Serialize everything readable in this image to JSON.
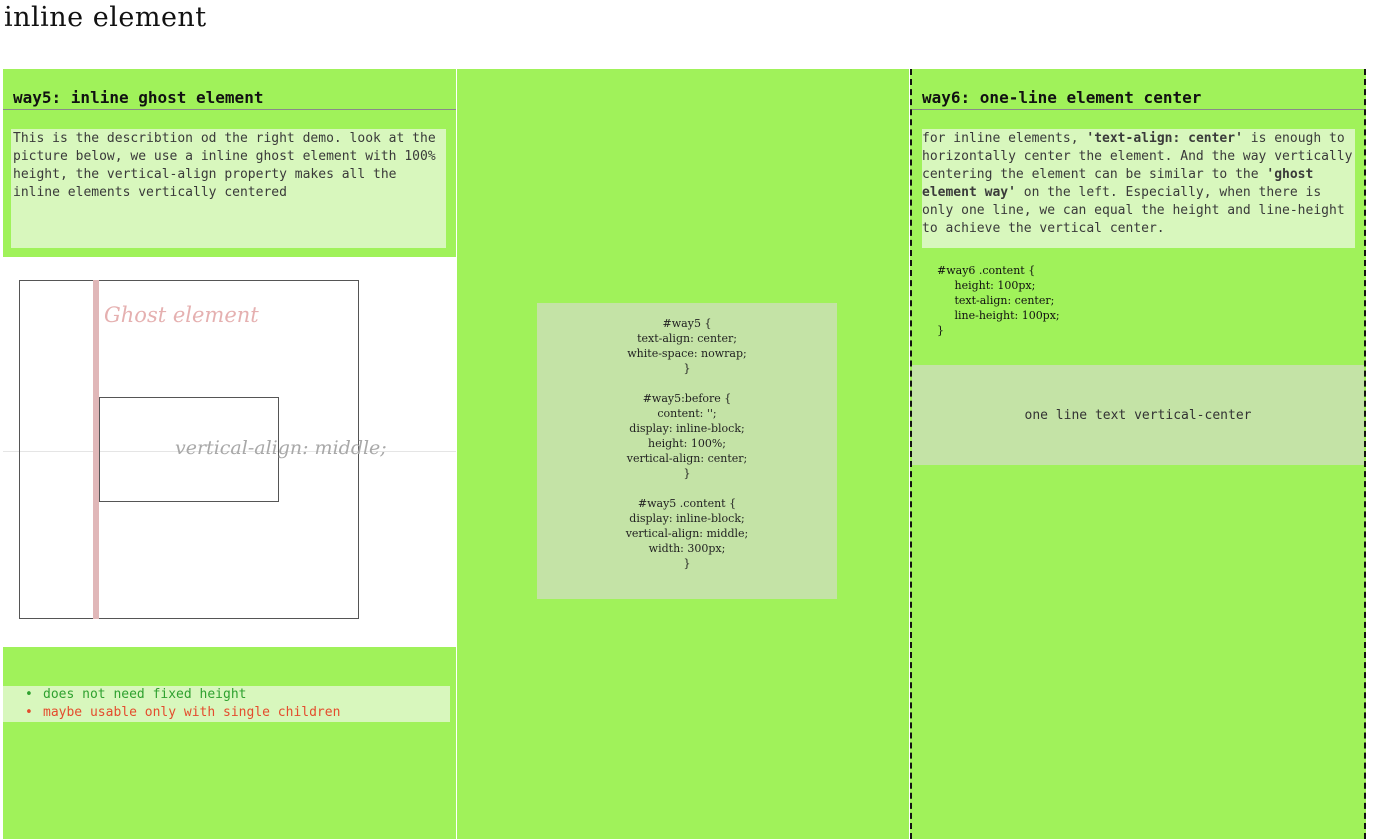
{
  "page": {
    "title": "inline element"
  },
  "way5": {
    "heading": "way5: inline ghost element",
    "description": "This is the describtion od the right demo. look at the picture below, we use a inline ghost element with 100% height, the vertical-align property makes all the inline elements vertically centered",
    "diagram": {
      "ghost_label": "Ghost element",
      "vertical_align_label": "vertical-align: middle;"
    },
    "bullets": [
      {
        "text": "does not need fixed height",
        "kind": "pro"
      },
      {
        "text": "maybe usable only with single children",
        "kind": "con"
      }
    ],
    "code": "#way5 {\ntext-align: center;\nwhite-space: nowrap;\n}\n\n#way5:before {\ncontent: '';\ndisplay: inline-block;\nheight: 100%;\nvertical-align: center;\n}\n\n#way5 .content {\ndisplay: inline-block;\nvertical-align: middle;\nwidth: 300px;\n}"
  },
  "way6": {
    "heading": "way6: one-line element center",
    "description_parts": [
      "for inline elements, ",
      "'text-align: center'",
      " is enough to horizontally center the element. And the way vertically centering the element can be similar to the ",
      "'ghost element way'",
      " on the left. Especially, when there is only one line, we can equal the height and line-height to achieve the vertical center."
    ],
    "code": "#way6 .content {\n     height: 100px;\n     text-align: center;\n     line-height: 100px;\n}",
    "demo_text": "one line text vertical-center"
  },
  "colors": {
    "panel_green": "#a0f25a",
    "light_green": "#d8f7bd",
    "code_green": "#c4e3a6",
    "pro_green": "#2fa12f",
    "con_red": "#e44c2d",
    "ghost_pink": "#e0b7b8"
  }
}
